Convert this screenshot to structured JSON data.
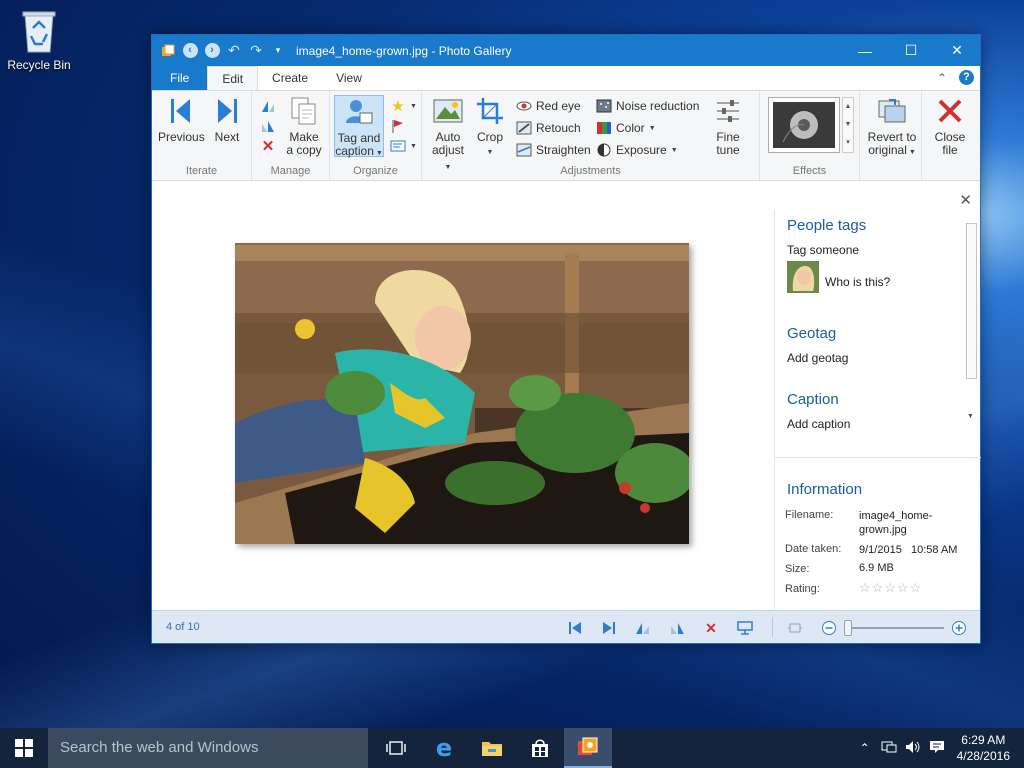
{
  "desktop": {
    "icons": [
      {
        "label": "Recycle Bin",
        "icon": "recycle-bin-icon"
      }
    ]
  },
  "window": {
    "title": "image4_home-grown.jpg - Photo Gallery",
    "tabs": [
      "File",
      "Edit",
      "Create",
      "View"
    ],
    "active_tab": "Edit",
    "ribbon": {
      "iterate": {
        "label": "Iterate",
        "previous": "Previous",
        "next": "Next"
      },
      "manage": {
        "label": "Manage",
        "make_copy_1": "Make",
        "make_copy_2": "a copy"
      },
      "organize": {
        "label": "Organize",
        "tag_1": "Tag and",
        "tag_2": "caption"
      },
      "adjustments": {
        "label": "Adjustments",
        "auto_1": "Auto",
        "auto_2": "adjust",
        "crop": "Crop",
        "red_eye": "Red eye",
        "retouch": "Retouch",
        "straighten": "Straighten",
        "noise_reduction": "Noise reduction",
        "color": "Color",
        "exposure": "Exposure",
        "fine_1": "Fine",
        "fine_2": "tune"
      },
      "effects": {
        "label": "Effects"
      },
      "revert_1": "Revert to",
      "revert_2": "original",
      "close_1": "Close",
      "close_2": "file"
    },
    "info_pane": {
      "people_tags": "People tags",
      "tag_someone": "Tag someone",
      "who_is_this": "Who is this?",
      "geotag": "Geotag",
      "add_geotag": "Add geotag",
      "caption": "Caption",
      "add_caption": "Add caption",
      "information": "Information",
      "filename_label": "Filename:",
      "filename_value": "image4_home-grown.jpg",
      "date_label": "Date taken:",
      "date_value": "9/1/2015   10:58 AM",
      "size_label": "Size:",
      "size_value": "6.9 MB",
      "rating_label": "Rating:",
      "rating_value": 0
    },
    "status": {
      "count": "4 of 10"
    }
  },
  "taskbar": {
    "search_placeholder": "Search the web and Windows",
    "time": "6:29 AM",
    "date": "4/28/2016"
  },
  "colors": {
    "accent": "#1979ca",
    "taskbar": "#14243c"
  }
}
